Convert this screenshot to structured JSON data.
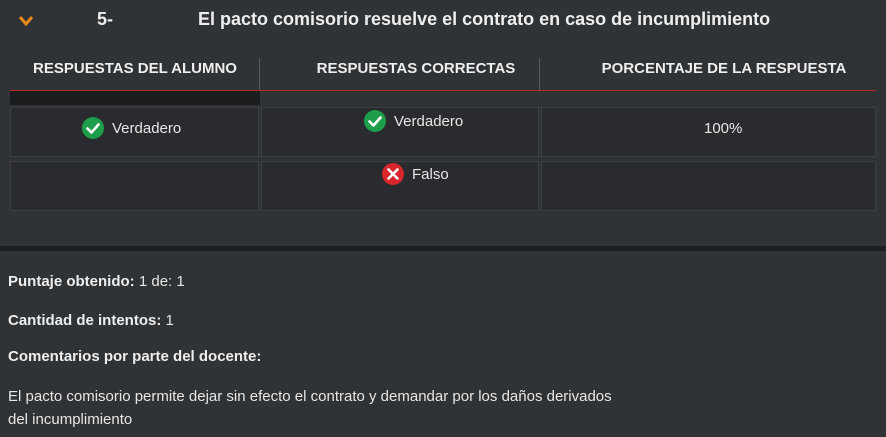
{
  "question": {
    "number": "5-",
    "title": "El pacto comisorio resuelve el contrato en caso de incumplimiento"
  },
  "table": {
    "headers": [
      "RESPUESTAS DEL ALUMNO",
      "RESPUESTAS CORRECTAS",
      "PORCENTAJE DE LA RESPUESTA"
    ],
    "rows": [
      {
        "student": "Verdadero",
        "correct": "Verdadero",
        "percentage": "100%"
      },
      {
        "student": "",
        "correct": "Falso",
        "percentage": ""
      }
    ]
  },
  "summary": {
    "score_label": "Puntaje obtenido:",
    "score_value": "1 de: 1",
    "attempts_label": "Cantidad de intentos:",
    "attempts_value": "1",
    "comments_label": "Comentarios por parte del docente:",
    "comment_text": "El pacto comisorio permite dejar sin efecto el contrato y demandar por los daños derivados del incumplimiento"
  },
  "colors": {
    "accent_orange": "#e8891b",
    "correct_green": "#1e9e4a",
    "wrong_red": "#d9262c",
    "header_line": "#b8292b"
  },
  "icons": {
    "expand": "chevron-down-icon",
    "correct": "check-circle-icon",
    "wrong": "x-circle-icon"
  }
}
